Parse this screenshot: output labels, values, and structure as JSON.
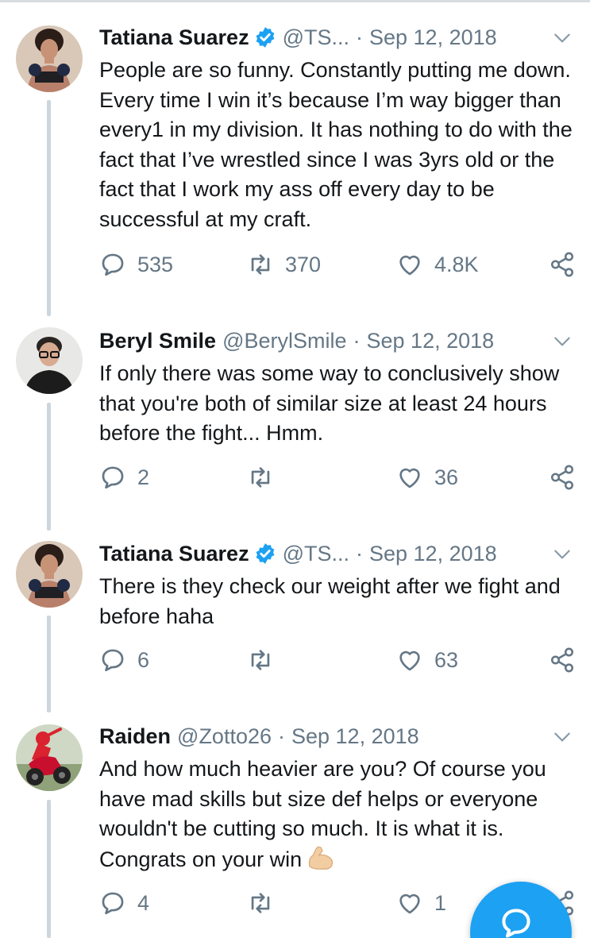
{
  "tweets": [
    {
      "author_name": "Tatiana Suarez",
      "verified": true,
      "handle": "@TS...",
      "separator": "·",
      "date": "Sep 12, 2018",
      "text": "People are so funny. Constantly putting me down. Every time I win it’s because I’m way bigger than every1 in my division. It has nothing to do with the fact that I’ve wrestled since I was 3yrs old or the fact that I work my ass off every day to be successful at my craft.",
      "replies": "535",
      "retweets": "370",
      "likes": "4.8K",
      "avatar": "fighter-portrait"
    },
    {
      "author_name": "Beryl Smile",
      "verified": false,
      "handle": "@BerylSmile",
      "separator": "·",
      "date": "Sep 12, 2018",
      "text": "If only there was some way to conclusively show that you're both of similar size at least 24 hours before the fight... Hmm.",
      "replies": "2",
      "retweets": "",
      "likes": "36",
      "avatar": "man-with-glasses-portrait"
    },
    {
      "author_name": "Tatiana Suarez",
      "verified": true,
      "handle": "@TS...",
      "separator": "·",
      "date": "Sep 12, 2018",
      "text": "There is they check our weight after we fight and before haha",
      "replies": "6",
      "retweets": "",
      "likes": "63",
      "avatar": "fighter-portrait"
    },
    {
      "author_name": "Raiden",
      "verified": false,
      "handle": "@Zotto26",
      "separator": "·",
      "date": "Sep 12, 2018",
      "text": "And how much heavier are you? Of course you have mad skills but size def helps or everyone wouldn't be cutting so much. It is what it is. Congrats on your win",
      "emoji": "flexed-biceps",
      "replies": "4",
      "retweets": "",
      "likes": "1",
      "avatar": "motorcycle-racer-portrait"
    }
  ],
  "icons": {
    "reply": "reply-bubble-icon",
    "retweet": "retweet-icon",
    "like": "heart-icon",
    "share": "share-icon",
    "more": "chevron-down-icon",
    "verified": "verified-badge-icon",
    "compose": "compose-reply-icon"
  },
  "colors": {
    "accent": "#1da1f2",
    "secondary_text": "#657786",
    "thread_line": "#ccd6dd"
  }
}
